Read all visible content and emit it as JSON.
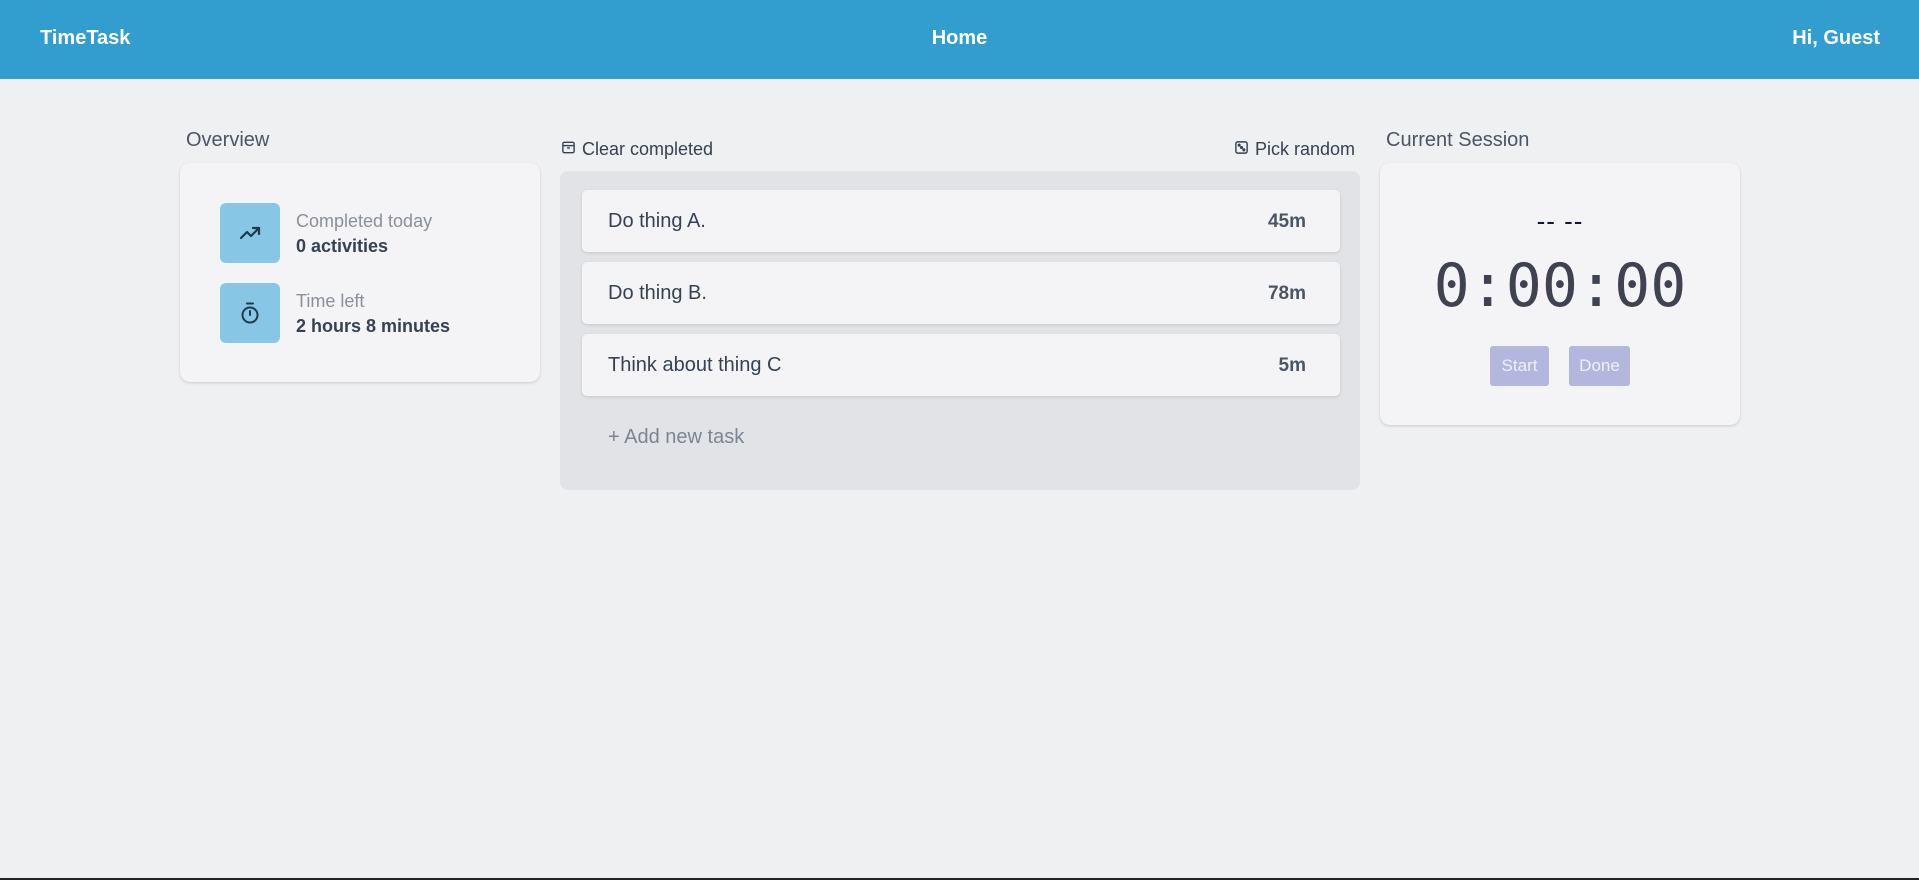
{
  "header": {
    "brand": "TimeTask",
    "title": "Home",
    "greeting": "Hi, Guest"
  },
  "overview": {
    "title": "Overview",
    "stats": [
      {
        "label": "Completed today",
        "value": "0 activities",
        "icon": "trending-up-icon"
      },
      {
        "label": "Time left",
        "value": "2 hours 8 minutes",
        "icon": "stopwatch-icon"
      }
    ]
  },
  "tasks": {
    "clear_label": "Clear completed",
    "random_label": "Pick random",
    "items": [
      {
        "name": "Do thing A.",
        "duration": "45m"
      },
      {
        "name": "Do thing B.",
        "duration": "78m"
      },
      {
        "name": "Think about thing C",
        "duration": "5m"
      }
    ],
    "add_label": "+ Add new task"
  },
  "session": {
    "title": "Current Session",
    "status": "-- --",
    "timer": "0:00:00",
    "start_label": "Start",
    "done_label": "Done"
  },
  "colors": {
    "header": "#319ecf",
    "tile": "#87c7e5",
    "button_disabled": "#b4b7dd"
  }
}
